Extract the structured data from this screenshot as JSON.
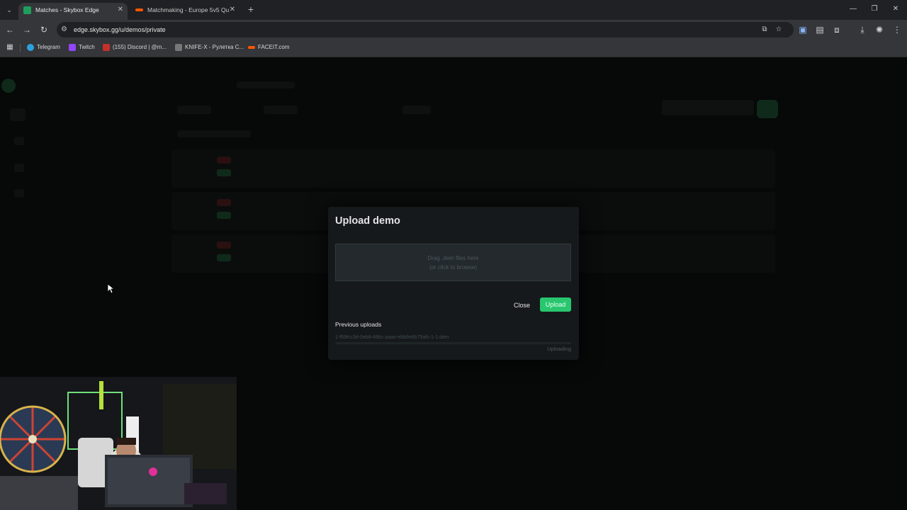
{
  "browser": {
    "tabs": [
      {
        "title": "Matches - Skybox Edge",
        "favicon": "skybox-icon",
        "color": "#1e9e5a"
      },
      {
        "title": "Matchmaking - Europe 5v5 Qu",
        "favicon": "faceit-icon",
        "color": "#ff5500"
      }
    ],
    "new_tab": "+",
    "url": "edge.skybox.gg/u/demos/private",
    "bookmarks": [
      {
        "label": "Telegram",
        "color": "#2aa3df"
      },
      {
        "label": "Twitch",
        "color": "#9146ff"
      },
      {
        "label": "(155) Discord | @m...",
        "color": "#c4302b"
      },
      {
        "label": "KNIFE-X - Рулетка С...",
        "color": "#777777"
      },
      {
        "label": "FACEIT.com",
        "color": "#ff5500"
      }
    ]
  },
  "modal": {
    "title": "Upload demo",
    "dropzone_line1": "Drag .dem files here",
    "dropzone_line2": "(or click to browse)",
    "close_label": "Close",
    "upload_label": "Upload",
    "previous_uploads_label": "Previous uploads",
    "uploads": [
      {
        "file": "1-f69fcc3d-0eb8-48bc-aaae-ebb6e8b75afc-1-1.dem",
        "status": "Uploading",
        "progress": 0.0
      }
    ]
  },
  "colors": {
    "accent": "#28c76f"
  }
}
